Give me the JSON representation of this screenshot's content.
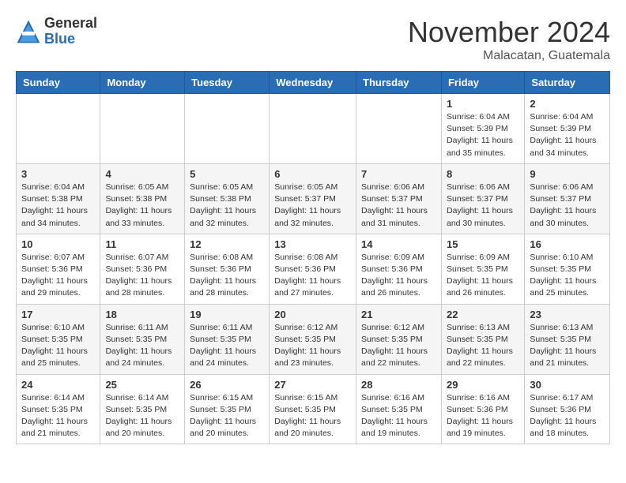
{
  "header": {
    "logo_general": "General",
    "logo_blue": "Blue",
    "month_title": "November 2024",
    "location": "Malacatan, Guatemala"
  },
  "days_of_week": [
    "Sunday",
    "Monday",
    "Tuesday",
    "Wednesday",
    "Thursday",
    "Friday",
    "Saturday"
  ],
  "weeks": [
    [
      {
        "day": "",
        "info": ""
      },
      {
        "day": "",
        "info": ""
      },
      {
        "day": "",
        "info": ""
      },
      {
        "day": "",
        "info": ""
      },
      {
        "day": "",
        "info": ""
      },
      {
        "day": "1",
        "info": "Sunrise: 6:04 AM\nSunset: 5:39 PM\nDaylight: 11 hours and 35 minutes."
      },
      {
        "day": "2",
        "info": "Sunrise: 6:04 AM\nSunset: 5:39 PM\nDaylight: 11 hours and 34 minutes."
      }
    ],
    [
      {
        "day": "3",
        "info": "Sunrise: 6:04 AM\nSunset: 5:38 PM\nDaylight: 11 hours and 34 minutes."
      },
      {
        "day": "4",
        "info": "Sunrise: 6:05 AM\nSunset: 5:38 PM\nDaylight: 11 hours and 33 minutes."
      },
      {
        "day": "5",
        "info": "Sunrise: 6:05 AM\nSunset: 5:38 PM\nDaylight: 11 hours and 32 minutes."
      },
      {
        "day": "6",
        "info": "Sunrise: 6:05 AM\nSunset: 5:37 PM\nDaylight: 11 hours and 32 minutes."
      },
      {
        "day": "7",
        "info": "Sunrise: 6:06 AM\nSunset: 5:37 PM\nDaylight: 11 hours and 31 minutes."
      },
      {
        "day": "8",
        "info": "Sunrise: 6:06 AM\nSunset: 5:37 PM\nDaylight: 11 hours and 30 minutes."
      },
      {
        "day": "9",
        "info": "Sunrise: 6:06 AM\nSunset: 5:37 PM\nDaylight: 11 hours and 30 minutes."
      }
    ],
    [
      {
        "day": "10",
        "info": "Sunrise: 6:07 AM\nSunset: 5:36 PM\nDaylight: 11 hours and 29 minutes."
      },
      {
        "day": "11",
        "info": "Sunrise: 6:07 AM\nSunset: 5:36 PM\nDaylight: 11 hours and 28 minutes."
      },
      {
        "day": "12",
        "info": "Sunrise: 6:08 AM\nSunset: 5:36 PM\nDaylight: 11 hours and 28 minutes."
      },
      {
        "day": "13",
        "info": "Sunrise: 6:08 AM\nSunset: 5:36 PM\nDaylight: 11 hours and 27 minutes."
      },
      {
        "day": "14",
        "info": "Sunrise: 6:09 AM\nSunset: 5:36 PM\nDaylight: 11 hours and 26 minutes."
      },
      {
        "day": "15",
        "info": "Sunrise: 6:09 AM\nSunset: 5:35 PM\nDaylight: 11 hours and 26 minutes."
      },
      {
        "day": "16",
        "info": "Sunrise: 6:10 AM\nSunset: 5:35 PM\nDaylight: 11 hours and 25 minutes."
      }
    ],
    [
      {
        "day": "17",
        "info": "Sunrise: 6:10 AM\nSunset: 5:35 PM\nDaylight: 11 hours and 25 minutes."
      },
      {
        "day": "18",
        "info": "Sunrise: 6:11 AM\nSunset: 5:35 PM\nDaylight: 11 hours and 24 minutes."
      },
      {
        "day": "19",
        "info": "Sunrise: 6:11 AM\nSunset: 5:35 PM\nDaylight: 11 hours and 24 minutes."
      },
      {
        "day": "20",
        "info": "Sunrise: 6:12 AM\nSunset: 5:35 PM\nDaylight: 11 hours and 23 minutes."
      },
      {
        "day": "21",
        "info": "Sunrise: 6:12 AM\nSunset: 5:35 PM\nDaylight: 11 hours and 22 minutes."
      },
      {
        "day": "22",
        "info": "Sunrise: 6:13 AM\nSunset: 5:35 PM\nDaylight: 11 hours and 22 minutes."
      },
      {
        "day": "23",
        "info": "Sunrise: 6:13 AM\nSunset: 5:35 PM\nDaylight: 11 hours and 21 minutes."
      }
    ],
    [
      {
        "day": "24",
        "info": "Sunrise: 6:14 AM\nSunset: 5:35 PM\nDaylight: 11 hours and 21 minutes."
      },
      {
        "day": "25",
        "info": "Sunrise: 6:14 AM\nSunset: 5:35 PM\nDaylight: 11 hours and 20 minutes."
      },
      {
        "day": "26",
        "info": "Sunrise: 6:15 AM\nSunset: 5:35 PM\nDaylight: 11 hours and 20 minutes."
      },
      {
        "day": "27",
        "info": "Sunrise: 6:15 AM\nSunset: 5:35 PM\nDaylight: 11 hours and 20 minutes."
      },
      {
        "day": "28",
        "info": "Sunrise: 6:16 AM\nSunset: 5:35 PM\nDaylight: 11 hours and 19 minutes."
      },
      {
        "day": "29",
        "info": "Sunrise: 6:16 AM\nSunset: 5:36 PM\nDaylight: 11 hours and 19 minutes."
      },
      {
        "day": "30",
        "info": "Sunrise: 6:17 AM\nSunset: 5:36 PM\nDaylight: 11 hours and 18 minutes."
      }
    ]
  ]
}
